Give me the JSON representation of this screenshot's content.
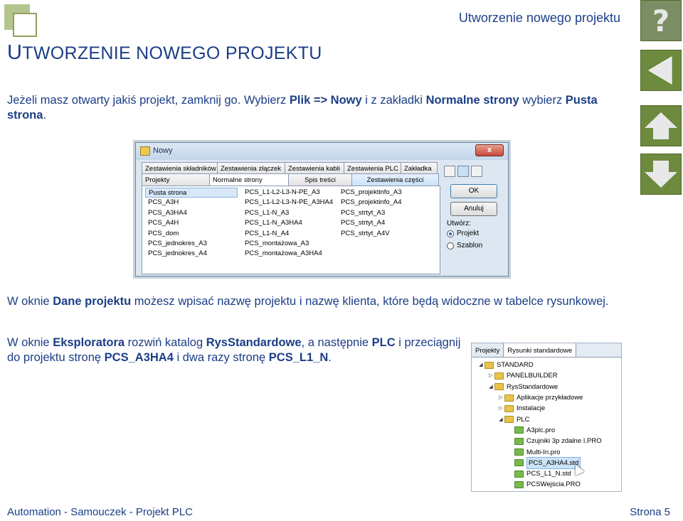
{
  "header": {
    "title": "Utworzenie nowego projektu",
    "help_glyph": "?"
  },
  "heading": {
    "first_letter": "U",
    "rest": "TWORZENIE NOWEGO PROJEKTU"
  },
  "paragraphs": {
    "p1": [
      {
        "t": "Jeżeli masz otwarty jakiś projekt, zamknij go. Wybierz ",
        "b": false
      },
      {
        "t": "Plik => Nowy",
        "b": true
      },
      {
        "t": " i z zakładki ",
        "b": false
      },
      {
        "t": "Normalne strony",
        "b": true
      },
      {
        "t": " wybierz ",
        "b": false
      },
      {
        "t": "Pusta strona",
        "b": true
      },
      {
        "t": ".",
        "b": false
      }
    ],
    "p2": [
      {
        "t": "W oknie ",
        "b": false
      },
      {
        "t": "Dane projektu",
        "b": true
      },
      {
        "t": " możesz wpisać nazwę projektu i nazwę klienta, które będą widoczne w tabelce rysunkowej.",
        "b": false
      }
    ],
    "p3": [
      {
        "t": "W oknie ",
        "b": false
      },
      {
        "t": "Eksploratora",
        "b": true
      },
      {
        "t": " rozwiń katalog ",
        "b": false
      },
      {
        "t": "RysStandardowe",
        "b": true
      },
      {
        "t": ", a następnie ",
        "b": false
      },
      {
        "t": "PLC",
        "b": true
      },
      {
        "t": " i przeciągnij do projektu stronę ",
        "b": false
      },
      {
        "t": "PCS_A3HA4",
        "b": true
      },
      {
        "t": " i dwa razy stronę ",
        "b": false
      },
      {
        "t": "PCS_L1_N",
        "b": true
      },
      {
        "t": ".",
        "b": false
      }
    ]
  },
  "dialog": {
    "title": "Nowy",
    "close_glyph": "x",
    "tabs_row1": [
      "Zestawienia składników",
      "Zestawienia złączek",
      "Zestawienia kabli",
      "Zestawienia PLC",
      "Zakładka"
    ],
    "tabs_row2": [
      "Projekty",
      "Normalne strony",
      "Spis treści",
      "Zestawienia części"
    ],
    "list_columns": [
      [
        "Pusta strona",
        "PCS_A3H",
        "PCS_A3HA4",
        "PCS_A4H",
        "PCS_dom",
        "PCS_jednokres_A3",
        "PCS_jednokres_A4"
      ],
      [
        "PCS_L1-L2-L3-N-PE_A3",
        "PCS_L1-L2-L3-N-PE_A3HA4",
        "PCS_L1-N_A3",
        "PCS_L1-N_A3HA4",
        "PCS_L1-N_A4",
        "PCS_montażowa_A3",
        "PCS_montażowa_A3HA4"
      ],
      [
        "PCS_projektinfo_A3",
        "PCS_projektinfo_A4",
        "PCS_strtyt_A3",
        "PCS_strtyt_A4",
        "PCS_strtyt_A4V"
      ]
    ],
    "ok_label": "OK",
    "cancel_label": "Anuluj",
    "create_label": "Utwórz:",
    "option_project": "Projekt",
    "option_template": "Szablon"
  },
  "explorer": {
    "tabs": [
      "Projekty",
      "Rysunki standardowe"
    ],
    "tree": [
      {
        "label": "STANDARD",
        "level": 0,
        "toggle": "◢",
        "type": "folder"
      },
      {
        "label": "PANELBUILDER",
        "level": 1,
        "toggle": "▷",
        "type": "folder"
      },
      {
        "label": "RysStandardowe",
        "level": 1,
        "toggle": "◢",
        "type": "folder"
      },
      {
        "label": "Aplikacje przykładowe",
        "level": 2,
        "toggle": "▷",
        "type": "folder"
      },
      {
        "label": "Instalacje",
        "level": 2,
        "toggle": "▷",
        "type": "folder"
      },
      {
        "label": "PLC",
        "level": 2,
        "toggle": "◢",
        "type": "folder"
      },
      {
        "label": "A3plc.pro",
        "level": 3,
        "toggle": "",
        "type": "file"
      },
      {
        "label": "Czujniki 3p zdalne I.PRO",
        "level": 3,
        "toggle": "",
        "type": "file"
      },
      {
        "label": "Multi-In.pro",
        "level": 3,
        "toggle": "",
        "type": "file"
      },
      {
        "label": "PCS_A3HA4.std",
        "level": 3,
        "toggle": "",
        "type": "file",
        "selected": true
      },
      {
        "label": "PCS_L1_N.std",
        "level": 3,
        "toggle": "",
        "type": "file"
      },
      {
        "label": "PCSWejścia.PRO",
        "level": 3,
        "toggle": "",
        "type": "file"
      }
    ]
  },
  "footer": {
    "left": "Automation - Samouczek - Projekt PLC",
    "right": "Strona 5"
  }
}
